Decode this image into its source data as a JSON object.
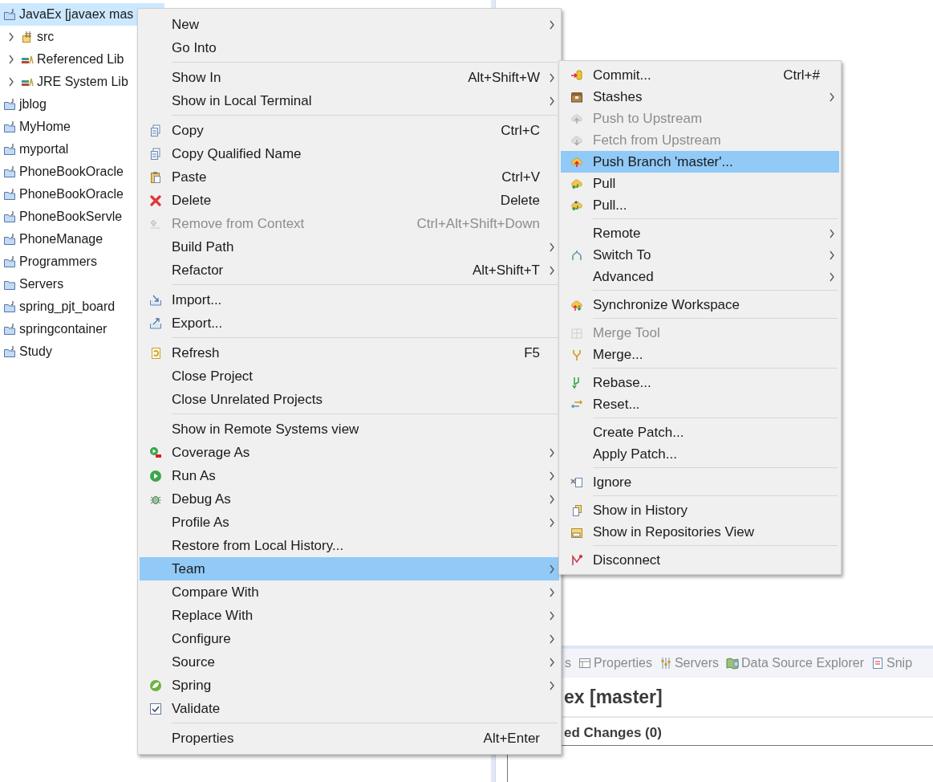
{
  "project_explorer": {
    "items": [
      {
        "label": "JavaEx [javaex mas",
        "selected": true,
        "children": [
          {
            "label": "src",
            "selected": false,
            "expanded": false
          },
          {
            "label": "Referenced Lib",
            "selected": false,
            "expanded": false
          },
          {
            "label": "JRE System Lib",
            "selected": false,
            "expanded": false
          }
        ]
      },
      {
        "label": "jblog",
        "selected": false
      },
      {
        "label": "MyHome",
        "selected": false
      },
      {
        "label": "myportal",
        "selected": false
      },
      {
        "label": "PhoneBookOracle",
        "selected": false
      },
      {
        "label": "PhoneBookOracle",
        "selected": false
      },
      {
        "label": "PhoneBookServle",
        "selected": false
      },
      {
        "label": "PhoneManage",
        "selected": false
      },
      {
        "label": "Programmers",
        "selected": false
      },
      {
        "label": "Servers",
        "selected": false
      },
      {
        "label": "spring_pjt_board",
        "selected": false
      },
      {
        "label": "springcontainer",
        "selected": false
      },
      {
        "label": "Study",
        "selected": false
      }
    ]
  },
  "context_menu": {
    "groups": [
      [
        {
          "label": "New",
          "submenu": true,
          "disabled": false,
          "selected": false
        },
        {
          "label": "Go Into",
          "submenu": false,
          "disabled": false,
          "selected": false
        }
      ],
      [
        {
          "label": "Show In",
          "shortcut": "Alt+Shift+W",
          "submenu": true,
          "disabled": false,
          "selected": false
        },
        {
          "label": "Show in Local Terminal",
          "submenu": true,
          "disabled": false,
          "selected": false
        }
      ],
      [
        {
          "label": "Copy",
          "shortcut": "Ctrl+C",
          "submenu": false,
          "disabled": false,
          "selected": false
        },
        {
          "label": "Copy Qualified Name",
          "submenu": false,
          "disabled": false,
          "selected": false
        },
        {
          "label": "Paste",
          "shortcut": "Ctrl+V",
          "submenu": false,
          "disabled": false,
          "selected": false
        },
        {
          "label": "Delete",
          "shortcut": "Delete",
          "submenu": false,
          "disabled": false,
          "selected": false
        },
        {
          "label": "Remove from Context",
          "shortcut": "Ctrl+Alt+Shift+Down",
          "submenu": false,
          "disabled": true,
          "selected": false
        },
        {
          "label": "Build Path",
          "submenu": true,
          "disabled": false,
          "selected": false
        },
        {
          "label": "Refactor",
          "shortcut": "Alt+Shift+T",
          "submenu": true,
          "disabled": false,
          "selected": false
        }
      ],
      [
        {
          "label": "Import...",
          "submenu": false,
          "disabled": false,
          "selected": false
        },
        {
          "label": "Export...",
          "submenu": false,
          "disabled": false,
          "selected": false
        }
      ],
      [
        {
          "label": "Refresh",
          "shortcut": "F5",
          "submenu": false,
          "disabled": false,
          "selected": false
        },
        {
          "label": "Close Project",
          "submenu": false,
          "disabled": false,
          "selected": false
        },
        {
          "label": "Close Unrelated Projects",
          "submenu": false,
          "disabled": false,
          "selected": false
        }
      ],
      [
        {
          "label": "Show in Remote Systems view",
          "submenu": false,
          "disabled": false,
          "selected": false
        },
        {
          "label": "Coverage As",
          "submenu": true,
          "disabled": false,
          "selected": false
        },
        {
          "label": "Run As",
          "submenu": true,
          "disabled": false,
          "selected": false
        },
        {
          "label": "Debug As",
          "submenu": true,
          "disabled": false,
          "selected": false
        },
        {
          "label": "Profile As",
          "submenu": true,
          "disabled": false,
          "selected": false
        },
        {
          "label": "Restore from Local History...",
          "submenu": false,
          "disabled": false,
          "selected": false
        },
        {
          "label": "Team",
          "submenu": true,
          "disabled": false,
          "selected": true
        },
        {
          "label": "Compare With",
          "submenu": true,
          "disabled": false,
          "selected": false
        },
        {
          "label": "Replace With",
          "submenu": true,
          "disabled": false,
          "selected": false
        },
        {
          "label": "Configure",
          "submenu": true,
          "disabled": false,
          "selected": false
        },
        {
          "label": "Source",
          "submenu": true,
          "disabled": false,
          "selected": false
        },
        {
          "label": "Spring",
          "submenu": true,
          "disabled": false,
          "selected": false
        },
        {
          "label": "Validate",
          "submenu": false,
          "disabled": false,
          "selected": false
        }
      ],
      [
        {
          "label": "Properties",
          "shortcut": "Alt+Enter",
          "submenu": false,
          "disabled": false,
          "selected": false
        }
      ]
    ]
  },
  "team_submenu": {
    "groups": [
      [
        {
          "label": "Commit...",
          "shortcut": "Ctrl+#",
          "submenu": false,
          "disabled": false,
          "selected": false
        },
        {
          "label": "Stashes",
          "submenu": true,
          "disabled": false,
          "selected": false
        },
        {
          "label": "Push to Upstream",
          "submenu": false,
          "disabled": true,
          "selected": false
        },
        {
          "label": "Fetch from Upstream",
          "submenu": false,
          "disabled": true,
          "selected": false
        },
        {
          "label": "Push Branch 'master'...",
          "submenu": false,
          "disabled": false,
          "selected": true
        },
        {
          "label": "Pull",
          "submenu": false,
          "disabled": false,
          "selected": false
        },
        {
          "label": "Pull...",
          "submenu": false,
          "disabled": false,
          "selected": false
        }
      ],
      [
        {
          "label": "Remote",
          "submenu": true,
          "disabled": false,
          "selected": false
        },
        {
          "label": "Switch To",
          "submenu": true,
          "disabled": false,
          "selected": false
        },
        {
          "label": "Advanced",
          "submenu": true,
          "disabled": false,
          "selected": false
        }
      ],
      [
        {
          "label": "Synchronize Workspace",
          "submenu": false,
          "disabled": false,
          "selected": false
        }
      ],
      [
        {
          "label": "Merge Tool",
          "submenu": false,
          "disabled": true,
          "selected": false
        },
        {
          "label": "Merge...",
          "submenu": false,
          "disabled": false,
          "selected": false
        }
      ],
      [
        {
          "label": "Rebase...",
          "submenu": false,
          "disabled": false,
          "selected": false
        },
        {
          "label": "Reset...",
          "submenu": false,
          "disabled": false,
          "selected": false
        }
      ],
      [
        {
          "label": "Create Patch...",
          "submenu": false,
          "disabled": false,
          "selected": false
        },
        {
          "label": "Apply Patch...",
          "submenu": false,
          "disabled": false,
          "selected": false
        }
      ],
      [
        {
          "label": "Ignore",
          "submenu": false,
          "disabled": false,
          "selected": false
        }
      ],
      [
        {
          "label": "Show in History",
          "submenu": false,
          "disabled": false,
          "selected": false
        },
        {
          "label": "Show in Repositories View",
          "submenu": false,
          "disabled": false,
          "selected": false
        }
      ],
      [
        {
          "label": "Disconnect",
          "submenu": false,
          "disabled": false,
          "selected": false
        }
      ]
    ]
  },
  "bottom_panel": {
    "tabs": [
      {
        "label": "s"
      },
      {
        "label": "Properties"
      },
      {
        "label": "Servers"
      },
      {
        "label": "Data Source Explorer"
      },
      {
        "label": "Snip"
      }
    ],
    "title": "ex [master]",
    "section": "ed Changes (0)"
  }
}
